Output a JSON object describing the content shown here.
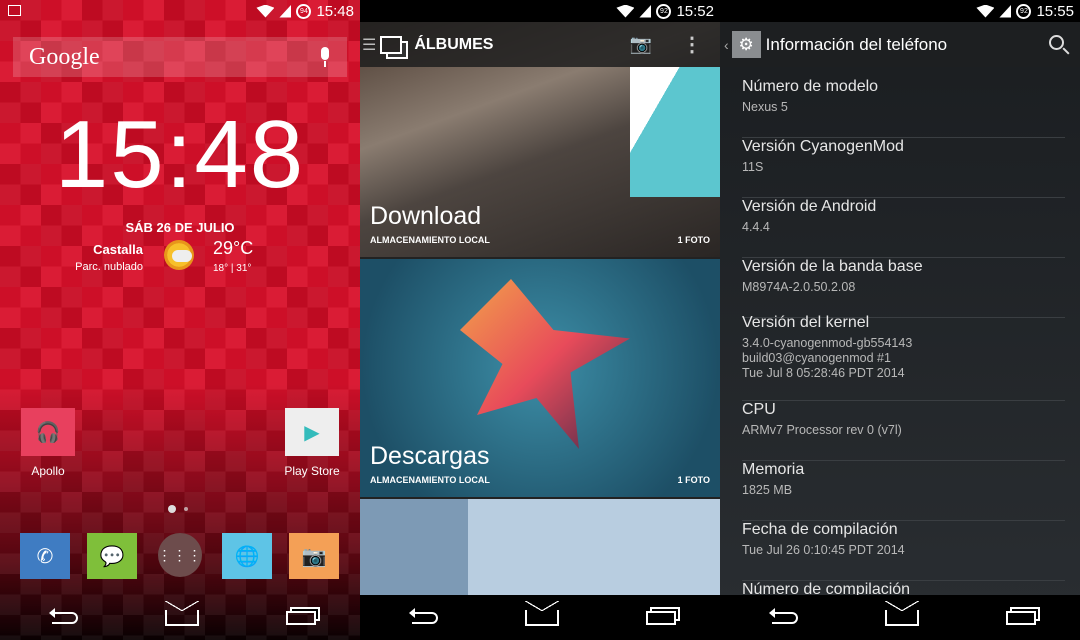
{
  "home": {
    "status_time": "15:48",
    "battery": "94",
    "search_logo": "Google",
    "clock": "15:48",
    "date": "SÁB 26 DE JULIO",
    "city": "Castalla",
    "condition": "Parc. nublado",
    "temp": "29°C",
    "range": "18° | 31°",
    "apps": [
      {
        "label": "Apollo",
        "icon": "headphones-icon",
        "color": "#e8405e"
      },
      {
        "label": "Play Store",
        "icon": "play-store-icon",
        "color": "#eeeeee"
      }
    ],
    "dock": [
      {
        "name": "phone",
        "icon": "phone-icon",
        "color": "#3f7cc2"
      },
      {
        "name": "messaging",
        "icon": "message-icon",
        "color": "#7fbf3a"
      },
      {
        "name": "app-drawer",
        "icon": "apps-grid-icon",
        "color": "#6d4c4c"
      },
      {
        "name": "browser",
        "icon": "globe-icon",
        "color": "#5ec4e6"
      },
      {
        "name": "camera",
        "icon": "camera-icon",
        "color": "#f4a056"
      }
    ]
  },
  "gallery": {
    "status_time": "15:52",
    "battery": "92",
    "title": "ÁLBUMES",
    "albums": [
      {
        "title": "Download",
        "sub": "ALMACENAMIENTO LOCAL",
        "count": "1 FOTO"
      },
      {
        "title": "Descargas",
        "sub": "ALMACENAMIENTO LOCAL",
        "count": "1 FOTO"
      }
    ]
  },
  "settings": {
    "status_time": "15:55",
    "battery": "92",
    "title": "Información del teléfono",
    "items": [
      {
        "label": "Número de modelo",
        "value": "Nexus 5"
      },
      {
        "label": "Versión CyanogenMod",
        "value": "11S"
      },
      {
        "label": "Versión de Android",
        "value": "4.4.4"
      },
      {
        "label": "Versión de la banda base",
        "value": "M8974A-2.0.50.2.08"
      },
      {
        "label": "Versión del kernel",
        "value": "3.4.0-cyanogenmod-gb554143\nbuild03@cyanogenmod #1\nTue Jul 8 05:28:46 PDT 2014"
      },
      {
        "label": "CPU",
        "value": "ARMv7 Processor rev 0 (v7l)"
      },
      {
        "label": "Memoria",
        "value": "1825 MB"
      },
      {
        "label": "Fecha de compilación",
        "value": "Tue Jul  26 0:10:45 PDT 2014"
      },
      {
        "label": "Número de compilación",
        "value": ""
      }
    ]
  }
}
